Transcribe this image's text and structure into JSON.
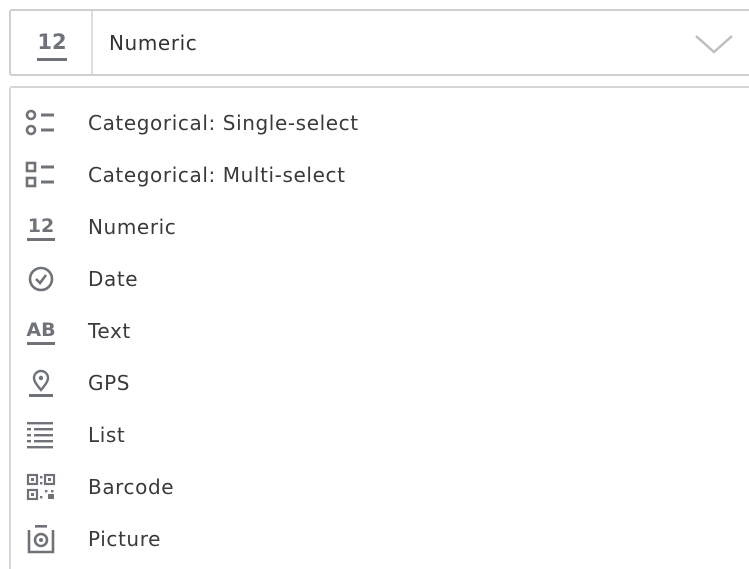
{
  "select": {
    "selected_label": "Numeric",
    "selected_icon": "numeric-12-icon",
    "chevron_icon": "chevron-down-icon"
  },
  "menu": {
    "items": [
      {
        "label": "Categorical: Single-select",
        "icon": "single-select-icon"
      },
      {
        "label": "Categorical: Multi-select",
        "icon": "multi-select-icon"
      },
      {
        "label": "Numeric",
        "icon": "numeric-12-icon"
      },
      {
        "label": "Date",
        "icon": "clock-icon"
      },
      {
        "label": "Text",
        "icon": "text-ab-icon"
      },
      {
        "label": "GPS",
        "icon": "location-pin-icon"
      },
      {
        "label": "List",
        "icon": "list-icon"
      },
      {
        "label": "Barcode",
        "icon": "qr-code-icon"
      },
      {
        "label": "Picture",
        "icon": "camera-icon"
      }
    ]
  },
  "icon_digits": "12",
  "icon_letters": "AB",
  "colors": {
    "icon": "#6f7378",
    "text": "#3a3a3a",
    "border": "#cfcfcf"
  }
}
